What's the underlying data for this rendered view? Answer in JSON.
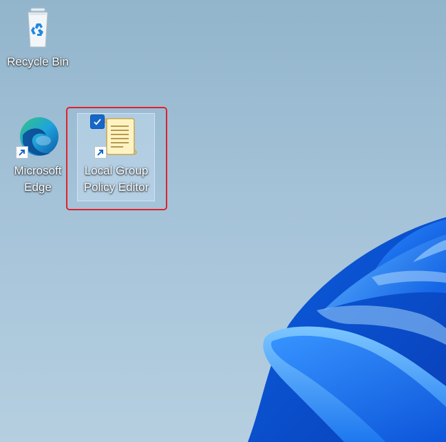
{
  "desktop": {
    "icons": [
      {
        "label": "Recycle Bin",
        "icon": "recycle-bin-icon"
      },
      {
        "label_line1": "Microsoft",
        "label_line2": "Edge",
        "icon": "edge-icon"
      },
      {
        "label_line1": "Local Group",
        "label_line2": "Policy Editor",
        "icon": "group-policy-icon",
        "selected": true
      }
    ]
  },
  "colors": {
    "wallpaper_bloom": "#1a73e8",
    "selection_highlight": "#e0202a",
    "checkbox": "#1668c8"
  }
}
